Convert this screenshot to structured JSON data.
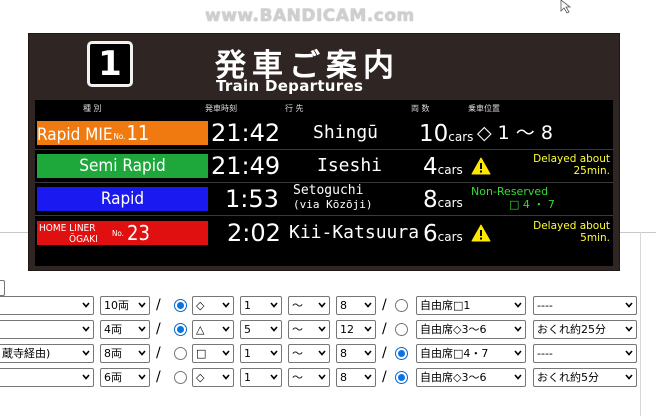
{
  "watermark": "www.BANDICAM.com",
  "board": {
    "track_number": "1",
    "title_ja": "発車ご案内",
    "title_en": "Train Departures",
    "headers": {
      "type": "種 別",
      "time": "発車時刻",
      "dest": "行 先",
      "cars": "両 数",
      "position": "乗車位置"
    },
    "trains": [
      {
        "type_name": "Rapid MIE",
        "type_no": "No.",
        "type_num": "11",
        "type_color": "#f07a10",
        "time": "21:42",
        "destination": "Shingū",
        "cars_num": "10",
        "cars_unit": "cars",
        "position": "◇ 1 〜 8",
        "note": ""
      },
      {
        "type_name": "Semi Rapid",
        "type_color": "#1ea83c",
        "time": "21:49",
        "destination": "Iseshi",
        "cars_num": "4",
        "cars_unit": "cars",
        "note_line1": "Delayed about",
        "note_line2": "25min.",
        "warn_icon": "warning-icon"
      },
      {
        "type_name": "Rapid",
        "type_color": "#1a1af0",
        "time": "1:53",
        "destination_main": "Setoguchi",
        "destination_sub": "(via Kōzōji)",
        "cars_num": "8",
        "cars_unit": "cars",
        "nr_line1": "Non-Reserved",
        "nr_line2": "□ 4 ・ 7"
      },
      {
        "type_line1": "HOME LINER",
        "type_line2": "ŌGAKI",
        "type_no": "No.",
        "type_num": "23",
        "type_color": "#e01010",
        "time": "2:02",
        "destination": "Kii-Katsuura",
        "cars_num": "6",
        "cars_unit": "cars",
        "note_line1": "Delayed about",
        "note_line2": "5min.",
        "warn_icon": "warning-icon"
      }
    ]
  },
  "controls": {
    "rows": [
      {
        "type": "",
        "cars": "10両",
        "radio1": true,
        "mark": "◇",
        "from": "1",
        "tilde": "〜",
        "to": "8",
        "radio2": false,
        "seat": "自由席□1",
        "delay": "----"
      },
      {
        "type": "",
        "cars": "4両",
        "radio1": true,
        "mark": "△",
        "from": "5",
        "tilde": "〜",
        "to": "12",
        "radio2": false,
        "seat": "自由席◇3〜6",
        "delay": "おくれ約25分"
      },
      {
        "type": "蔵寺経由)",
        "cars": "8両",
        "radio1": false,
        "mark": "□",
        "from": "1",
        "tilde": "〜",
        "to": "8",
        "radio2": true,
        "seat": "自由席□4・7",
        "delay": "----"
      },
      {
        "type": "",
        "cars": "6両",
        "radio1": false,
        "mark": "◇",
        "from": "1",
        "tilde": "〜",
        "to": "8",
        "radio2": true,
        "seat": "自由席◇3〜6",
        "delay": "おくれ約5分"
      }
    ],
    "slash": "/"
  }
}
